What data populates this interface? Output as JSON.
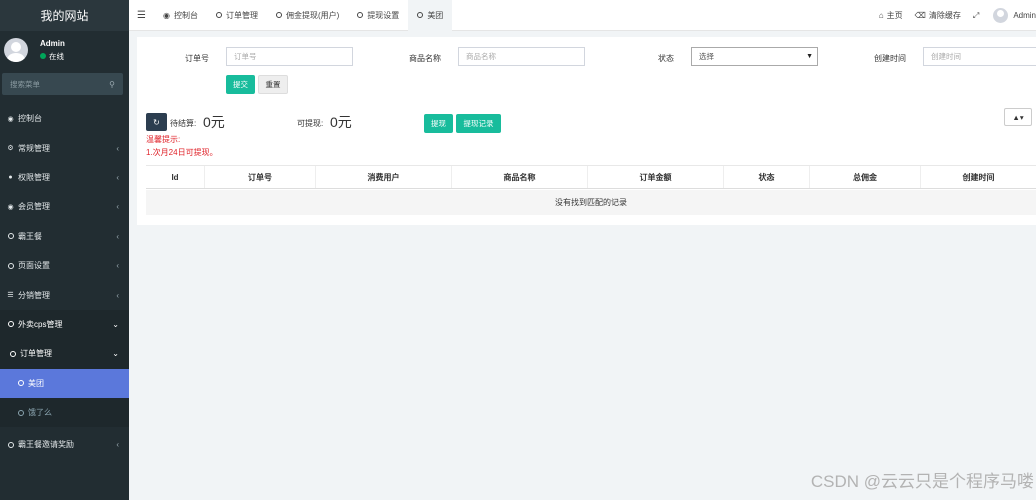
{
  "sidebar": {
    "logo": "我的网站",
    "user": {
      "name": "Admin",
      "status": "在线"
    },
    "search_placeholder": "搜索菜单",
    "items": [
      {
        "label": "控制台",
        "icon": "dashboard-icon"
      },
      {
        "label": "常规管理",
        "icon": "cogs-icon"
      },
      {
        "label": "权限管理",
        "icon": "group-icon"
      },
      {
        "label": "会员管理",
        "icon": "user-circle-icon"
      },
      {
        "label": "霸王餐",
        "icon": "circle-icon"
      },
      {
        "label": "页面设置",
        "icon": "circle-icon"
      },
      {
        "label": "分销管理",
        "icon": "list-icon"
      },
      {
        "label": "外卖cps管理",
        "icon": "circle-icon"
      },
      {
        "label": "订单管理",
        "icon": "circle-icon"
      },
      {
        "label": "美团",
        "icon": "circle-icon"
      },
      {
        "label": "饿了么",
        "icon": "circle-icon"
      },
      {
        "label": "霸王餐邀请奖励",
        "icon": "circle-icon"
      }
    ]
  },
  "topbar": {
    "tabs": [
      {
        "label": "控制台",
        "icon": "dashboard-icon"
      },
      {
        "label": "订单管理",
        "icon": "circle-icon"
      },
      {
        "label": "佣金提现(用户)",
        "icon": "circle-icon"
      },
      {
        "label": "提现设置",
        "icon": "circle-icon"
      },
      {
        "label": "美团",
        "icon": "circle-icon"
      }
    ],
    "home": "主页",
    "clear_cache": "清除缓存",
    "user": "Admin"
  },
  "filters": {
    "order_no_label": "订单号",
    "order_no_placeholder": "订单号",
    "product_label": "商品名称",
    "product_placeholder": "商品名称",
    "status_label": "状态",
    "status_value": "选择",
    "created_label": "创建时间",
    "created_placeholder": "创建时间",
    "submit": "提交",
    "reset": "重置"
  },
  "stats": {
    "pending_label": "待结算:",
    "pending_value": "0元",
    "withdrawable_label": "可提现:",
    "withdrawable_value": "0元",
    "withdraw_btn": "提现",
    "withdraw_record_btn": "提现记录",
    "tip_title": "温馨提示:",
    "tip_text": "1.次月24日可提现。"
  },
  "table": {
    "columns": [
      "Id",
      "订单号",
      "消费用户",
      "商品名称",
      "订单金额",
      "状态",
      "总佣金",
      "创建时间"
    ],
    "empty": "没有找到匹配的记录"
  },
  "watermark": "CSDN @云云只是个程序马喽"
}
